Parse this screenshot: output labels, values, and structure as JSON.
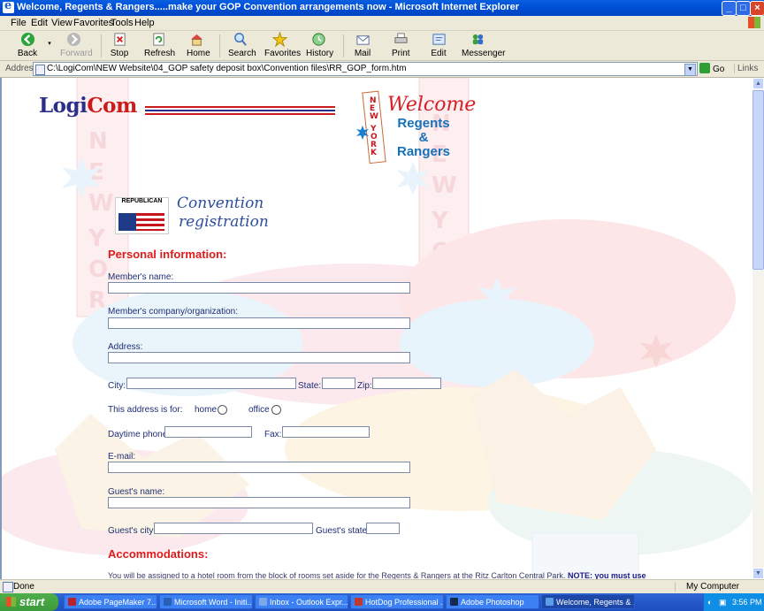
{
  "window": {
    "title": "Welcome, Regents & Rangers.....make your GOP Convention arrangements now - Microsoft Internet Explorer"
  },
  "menu": [
    "File",
    "Edit",
    "View",
    "Favorites",
    "Tools",
    "Help"
  ],
  "toolbar": {
    "back": "Back",
    "forward": "Forward",
    "stop": "Stop",
    "refresh": "Refresh",
    "home": "Home",
    "search": "Search",
    "favorites": "Favorites",
    "history": "History",
    "mail": "Mail",
    "print": "Print",
    "edit": "Edit",
    "messenger": "Messenger"
  },
  "address": {
    "label": "Address",
    "url": "C:\\LogiCom\\NEW Website\\04_GOP safety deposit box\\Convention files\\RR_GOP_form.htm",
    "go": "Go",
    "links": "Links"
  },
  "page": {
    "logo_a": "Logi",
    "logo_b": "Com",
    "welcome": "Welcome",
    "regents": "Regents",
    "amp": "&",
    "rangers": "Rangers",
    "republican_logo_text": "REPUBLICAN",
    "convention_1": "Convention",
    "convention_2": "registration",
    "personal_heading": "Personal information:",
    "labels": {
      "member_name": "Member's name:",
      "company": "Member's company/organization:",
      "address": "Address:",
      "city": "City:",
      "state": "State:",
      "zip": "Zip:",
      "address_for": "This address is for:",
      "home": "home",
      "office": "office",
      "day_phone": "Daytime phone:",
      "fax": "Fax:",
      "email": "E-mail:",
      "guest_name": "Guest's name:",
      "guest_city": "Guest's city:",
      "guest_state": "Guest's state:"
    },
    "accom_heading": "Accommodations:",
    "accom_text": "You will be assigned to a hotel room from the block of rooms set aside for the Regents & Rangers at the Ritz Carlton Central Park.",
    "accom_note": "NOTE: you must use"
  },
  "status": {
    "text": "Done",
    "zone": "My Computer"
  },
  "taskbar": {
    "start": "start",
    "tasks": [
      "Adobe PageMaker 7....",
      "Microsoft Word - Initi...",
      "Inbox - Outlook Expr...",
      "HotDog Professional ...",
      "Adobe Photoshop",
      "Welcome, Regents & ..."
    ],
    "clock": "3:56 PM"
  },
  "colors": {
    "heading": "#e01b1b",
    "link_blue": "#1671b7",
    "title_bar": "#0050d8"
  }
}
